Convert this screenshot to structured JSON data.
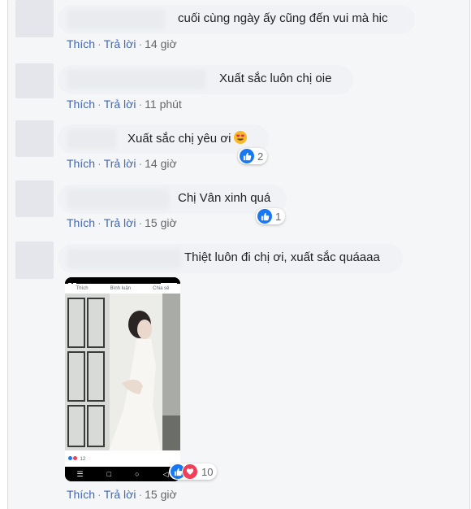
{
  "actions": {
    "like": "Thích",
    "reply": "Trả lời",
    "sep": "·"
  },
  "comments": [
    {
      "text": "cuối cùng ngày ấy cũng đến vui mà hic",
      "time": "14 giờ"
    },
    {
      "text": "Xuất sắc luôn chị oie",
      "time": "11 phút"
    },
    {
      "text": "Xuất sắc chị yêu ơi",
      "emoji": "heart-eyes-emoji",
      "time": "14 giờ",
      "reaction_count": "2"
    },
    {
      "text": "Chị Vân xinh quá",
      "time": "15 giờ",
      "reaction_count": "1"
    },
    {
      "text": "Thiệt luôn đi chị ơi, xuất sắc quáaaa",
      "time": "15 giờ",
      "reaction_count": "10"
    }
  ],
  "attachment": {
    "tab_like": "Thích",
    "tab_comment": "Bình luận",
    "tab_share": "Chia sẻ",
    "footer_count": "12"
  },
  "colors": {
    "link": "#4267b2",
    "bubble": "#f0f2f5",
    "like": "#1877f2",
    "love": "#f33e58"
  }
}
